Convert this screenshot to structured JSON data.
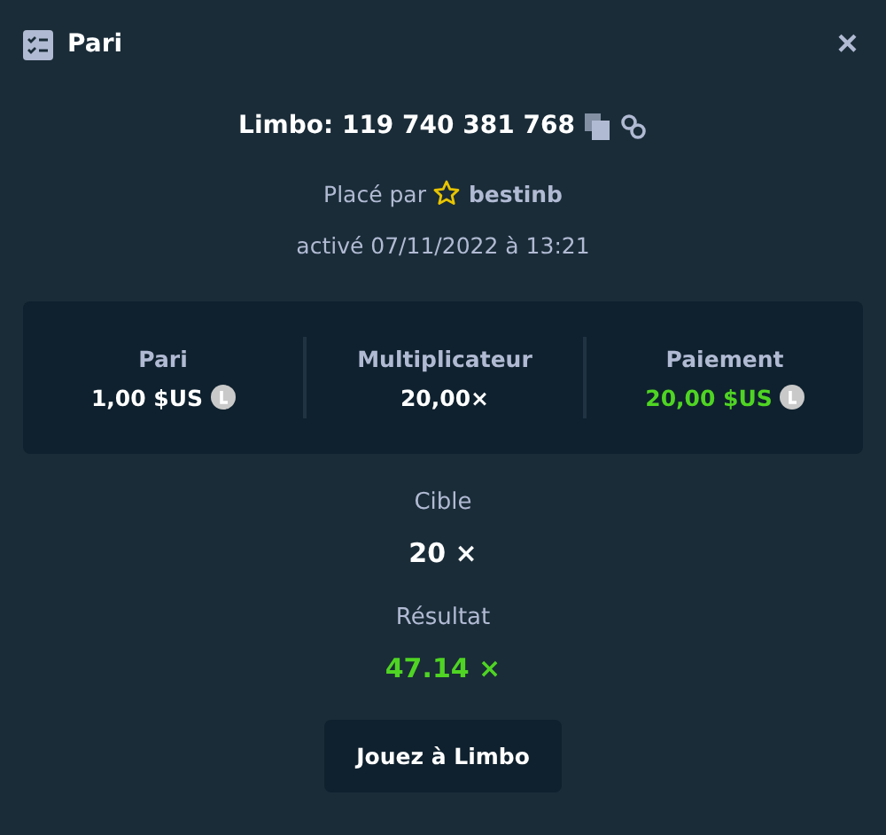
{
  "header": {
    "title": "Pari",
    "close": "×"
  },
  "bet_id": {
    "label": "Limbo: 119 740 381 768"
  },
  "placed_by": {
    "label": "Placé par",
    "user": "bestinb"
  },
  "activated": "activé 07/11/2022 à 13:21",
  "stats": [
    {
      "label": "Pari",
      "value": "1,00 $US",
      "coin": true,
      "positive": false
    },
    {
      "label": "Multiplicateur",
      "value": "20,00×",
      "coin": false,
      "positive": false
    },
    {
      "label": "Paiement",
      "value": "20,00 $US",
      "coin": true,
      "positive": true
    }
  ],
  "results": [
    {
      "label": "Cible",
      "value": "20 ×",
      "positive": false
    },
    {
      "label": "Résultat",
      "value": "47.14 ×",
      "positive": true
    }
  ],
  "button": "Jouez à Limbo"
}
